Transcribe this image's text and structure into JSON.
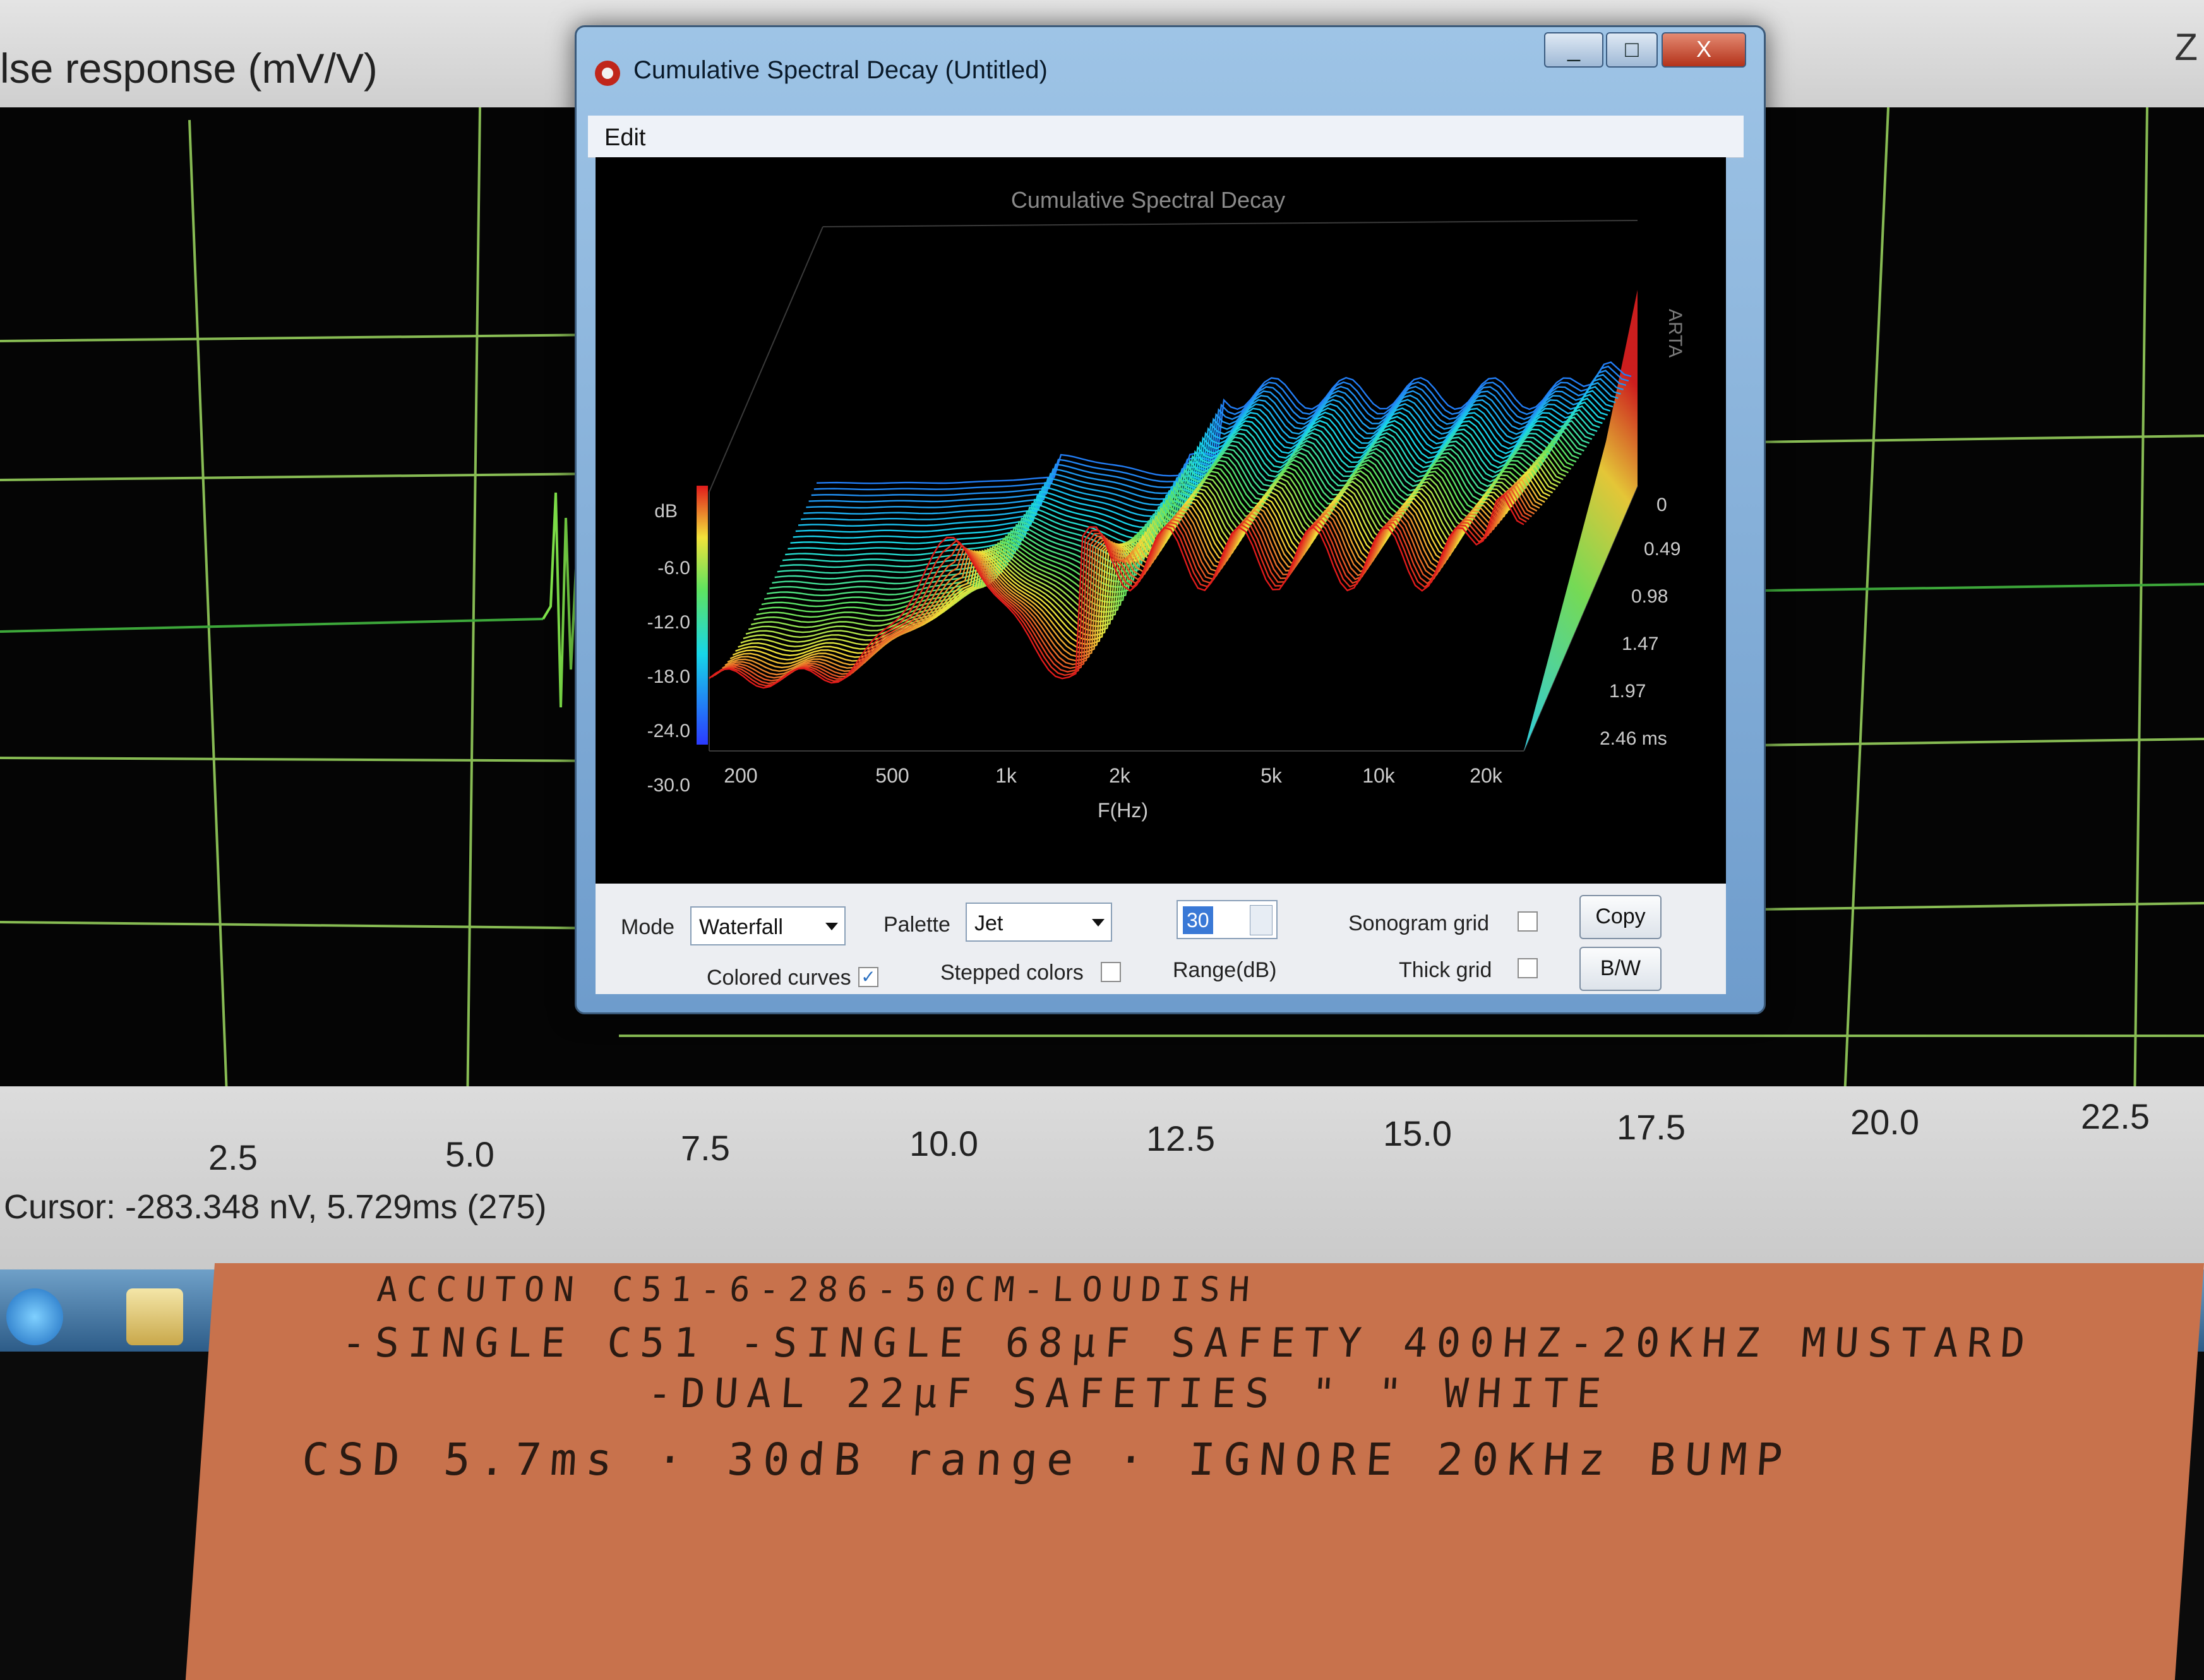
{
  "background": {
    "title": "lse response (mV/V)",
    "corner_text": "Z",
    "x_ticks": [
      "2.5",
      "5.0",
      "7.5",
      "10.0",
      "12.5",
      "15.0",
      "17.5",
      "20.0",
      "22.5"
    ],
    "cursor_readout": "Cursor: -283.348 nV, 5.729ms (275)"
  },
  "window": {
    "title": "Cumulative Spectral Decay  (Untitled)",
    "buttons": {
      "minimize": "_",
      "maximize": "□",
      "close": "X"
    },
    "menu": {
      "edit": "Edit"
    },
    "plot": {
      "title": "Cumulative Spectral Decay",
      "watermark": "ARTA",
      "db_label": "dB",
      "db_ticks": [
        "-6.0",
        "-12.0",
        "-18.0",
        "-24.0",
        "-30.0"
      ],
      "freq_ticks": [
        "200",
        "500",
        "1k",
        "2k",
        "5k",
        "10k",
        "20k"
      ],
      "x_label": "F(Hz)",
      "time_ticks": [
        "0",
        "0.49",
        "0.98",
        "1.47",
        "1.97",
        "2.46 ms"
      ]
    },
    "controls": {
      "mode_label": "Mode",
      "mode_value": "Waterfall",
      "palette_label": "Palette",
      "palette_value": "Jet",
      "range_value": "30",
      "range_label": "Range(dB)",
      "sonogram_grid_label": "Sonogram grid",
      "thick_grid_label": "Thick grid",
      "colored_curves_label": "Colored curves",
      "colored_curves_checked": "✓",
      "stepped_colors_label": "Stepped colors",
      "copy_button": "Copy",
      "bw_button": "B/W"
    }
  },
  "note": {
    "line1": "ACCUTON C51-6-286-50CM-LOUDISH",
    "line2": "-SINGLE C51  -SINGLE 68µF SAFETY  400HZ-20KHZ  MUSTARD",
    "line3": "-DUAL 22µF SAFETIES   \"      \"    WHITE",
    "line4": "CSD  5.7ms · 30dB range · IGNORE 20KHz BUMP"
  },
  "colors": {
    "trace": "#7fe34a",
    "grid": "#a7e06a",
    "window_frame": "#6e9ccc",
    "note_card": "#c8724c"
  }
}
